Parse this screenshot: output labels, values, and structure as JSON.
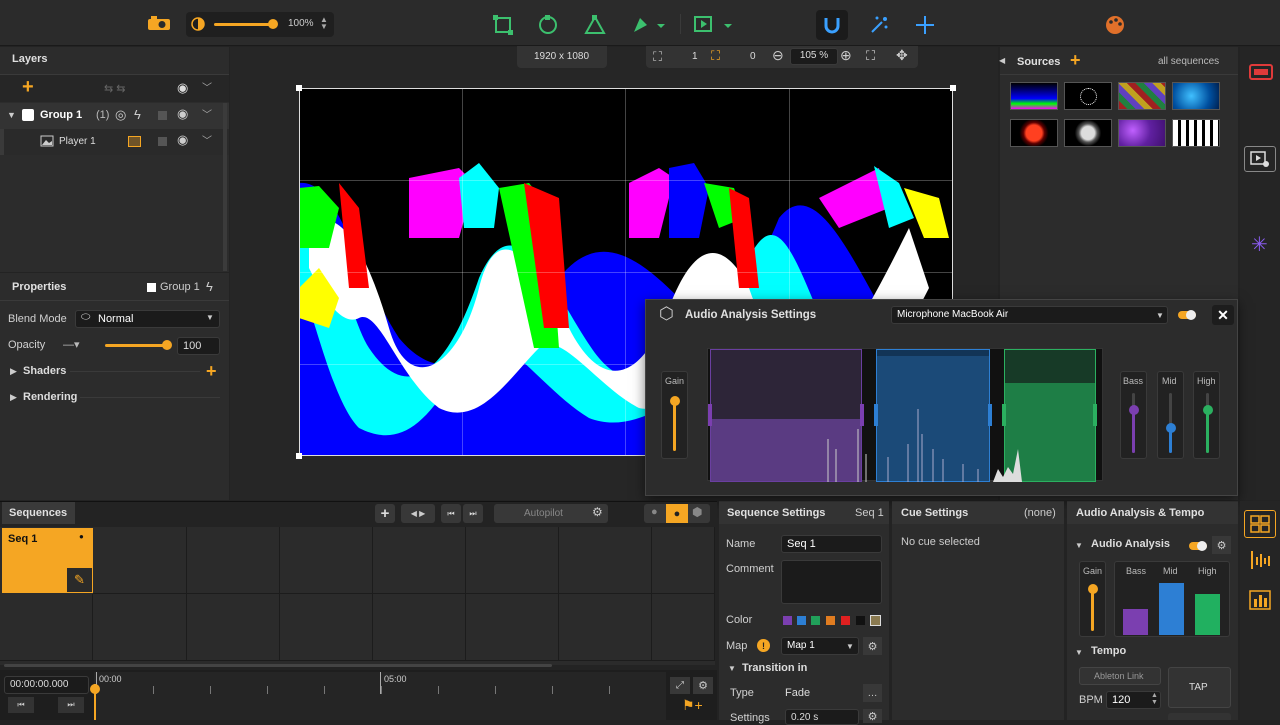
{
  "toolbar": {
    "opacity_value": "100%",
    "accent": "#f5a623"
  },
  "layers": {
    "title": "Layers",
    "group_name": "Group 1",
    "group_count": "(1)",
    "player_name": "Player 1"
  },
  "canvas": {
    "resolution": "1920 x 1080",
    "field1": "1",
    "field2": "0",
    "zoom": "105 %"
  },
  "sources": {
    "title": "Sources",
    "filter": "all sequences"
  },
  "properties": {
    "title": "Properties",
    "group": "Group 1",
    "blend_label": "Blend Mode",
    "blend_value": "Normal",
    "opacity_label": "Opacity",
    "opacity_value": "100",
    "shaders": "Shaders",
    "rendering": "Rendering"
  },
  "audio_popup": {
    "title": "Audio Analysis Settings",
    "device": "Microphone MacBook Air",
    "gain": "Gain",
    "bass": "Bass",
    "mid": "Mid",
    "high": "High"
  },
  "sequences": {
    "tab": "Sequences",
    "autopilot": "Autopilot",
    "seq1": "Seq 1",
    "time": "00:00:00.000",
    "tick0": "00:00",
    "tick1": "05:00"
  },
  "seq_settings": {
    "title": "Sequence Settings",
    "seq": "Seq 1",
    "name_label": "Name",
    "name_value": "Seq 1",
    "comment_label": "Comment",
    "color_label": "Color",
    "map_label": "Map",
    "map_value": "Map 1",
    "transition": "Transition in",
    "type_label": "Type",
    "type_value": "Fade",
    "settings_label": "Settings",
    "settings_value": "0.20 s",
    "colors": [
      "#7b3fb0",
      "#2d7fd4",
      "#21a05a",
      "#e07c20",
      "#e02020",
      "#111111",
      "#8a7a50"
    ]
  },
  "cue_settings": {
    "title": "Cue Settings",
    "none": "(none)",
    "empty": "No cue selected"
  },
  "audio_tempo": {
    "title": "Audio Analysis & Tempo",
    "section": "Audio Analysis",
    "gain": "Gain",
    "bass": "Bass",
    "mid": "Mid",
    "high": "High",
    "tempo": "Tempo",
    "ableton": "Ableton Link",
    "bpm_label": "BPM",
    "bpm_value": "120",
    "tap": "TAP"
  }
}
